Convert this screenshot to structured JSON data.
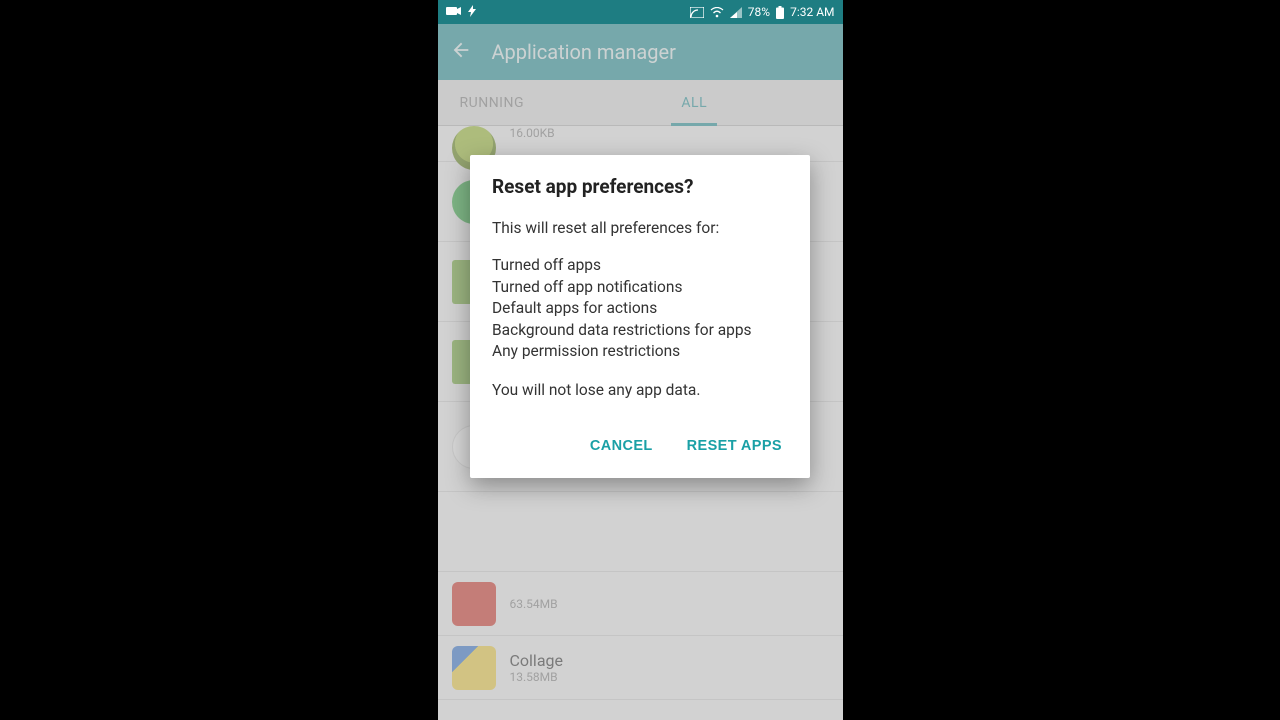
{
  "status": {
    "battery_pct": "78%",
    "time": "7:32 AM"
  },
  "header": {
    "title": "Application manager"
  },
  "tabs": {
    "running": "RUNNING",
    "all": "ALL"
  },
  "list": {
    "partial_size": "16.00KB",
    "row_red_size": "63.54MB",
    "row_collage_name": "Collage",
    "row_collage_size": "13.58MB"
  },
  "dialog": {
    "title": "Reset app preferences?",
    "intro": "This will reset all preferences for:",
    "item1": "Turned off apps",
    "item2": "Turned off app notifications",
    "item3": "Default apps for actions",
    "item4": "Background data restrictions for apps",
    "item5": "Any permission restrictions",
    "footer": "You will not lose any app data.",
    "cancel": "CANCEL",
    "confirm": "RESET APPS"
  }
}
